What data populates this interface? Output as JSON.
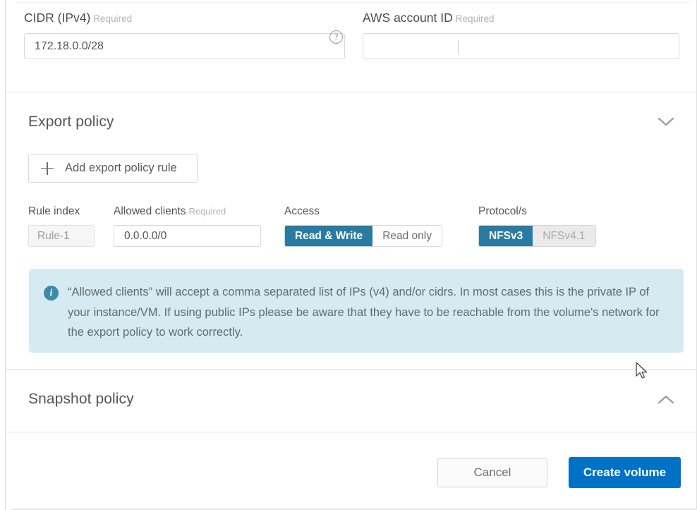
{
  "fields": {
    "cidr": {
      "label": "CIDR (IPv4)",
      "required_tag": "Required",
      "value": "172.18.0.0/28",
      "help_icon": "question-mark-circle-icon",
      "help_glyph": "?"
    },
    "aws_account": {
      "label": "AWS account ID",
      "required_tag": "Required",
      "value": "",
      "placeholder": ""
    }
  },
  "export_policy": {
    "title": "Export policy",
    "collapse_icon": "chevron-down-icon",
    "add_rule_label": "Add export policy rule",
    "add_rule_icon": "plus-icon",
    "columns": {
      "rule_index": "Rule index",
      "allowed_clients": "Allowed clients",
      "allowed_clients_required": "Required",
      "access": "Access",
      "protocols": "Protocol/s"
    },
    "rule": {
      "index_value": "Rule-1",
      "allowed_clients_value": "0.0.0.0/0",
      "access_options": [
        {
          "label": "Read & Write",
          "state": "active"
        },
        {
          "label": "Read only",
          "state": "inactive-white"
        }
      ],
      "protocol_options": [
        {
          "label": "NFSv3",
          "state": "active"
        },
        {
          "label": "NFSv4.1",
          "state": "inactive-grey"
        }
      ]
    },
    "info": {
      "icon": "info-circle-icon",
      "icon_glyph": "i",
      "text": "“Allowed clients” will accept a comma separated list of IPs (v4) and/or cidrs. In most cases this is the private IP of your instance/VM. If using public IPs please be aware that they have to be reachable from the volume's network for the export policy to work correctly."
    }
  },
  "snapshot_policy": {
    "title": "Snapshot policy",
    "collapse_icon": "chevron-up-icon"
  },
  "footer": {
    "cancel_label": "Cancel",
    "create_label": "Create volume"
  },
  "colors": {
    "accent_blue": "#0072c6",
    "toggle_blue": "#2a7ba2",
    "info_bg": "#d6eaf1",
    "info_icon": "#3c89ab",
    "border": "#d8d8d8"
  }
}
